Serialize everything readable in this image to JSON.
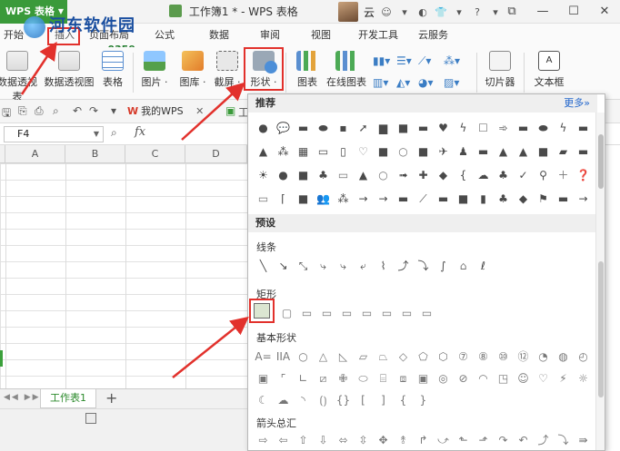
{
  "watermark": {
    "title": "河东软件园",
    "url": "www.pc0359.cn"
  },
  "titlebar": {
    "app": "WPS 表格",
    "doc_title": "工作簿1 * - WPS 表格",
    "user": "云",
    "help": "?"
  },
  "menu": {
    "tabs": [
      "开始",
      "插入",
      "页面布局",
      "公式",
      "数据",
      "审阅",
      "视图",
      "开发工具",
      "云服务"
    ]
  },
  "ribbon": {
    "items": [
      "数据透视表",
      "数据透视图",
      "表格",
      "图片",
      "图库",
      "截屏",
      "形状",
      "图表",
      "在线图表",
      "切片器",
      "文本框"
    ]
  },
  "quick_access": {
    "tab_label": "我的WPS",
    "tab2_label": "工"
  },
  "formula_bar": {
    "name_box": "F4",
    "fx": "fx"
  },
  "grid": {
    "columns": [
      "A",
      "B",
      "C",
      "D"
    ]
  },
  "sheets": {
    "tabs": [
      "工作表1"
    ],
    "add": "+"
  },
  "shapes_panel": {
    "recommended": "推荐",
    "more": "更多»",
    "presets": "预设",
    "lines": "线条",
    "rectangles": "矩形",
    "basic": "基本形状",
    "arrows": "箭头总汇",
    "basic_row1_text": [
      "A=",
      "IIA"
    ]
  },
  "colors": {
    "accent_red": "#e2312c",
    "wps_green": "#3a9a3a",
    "link_blue": "#2266cc"
  }
}
